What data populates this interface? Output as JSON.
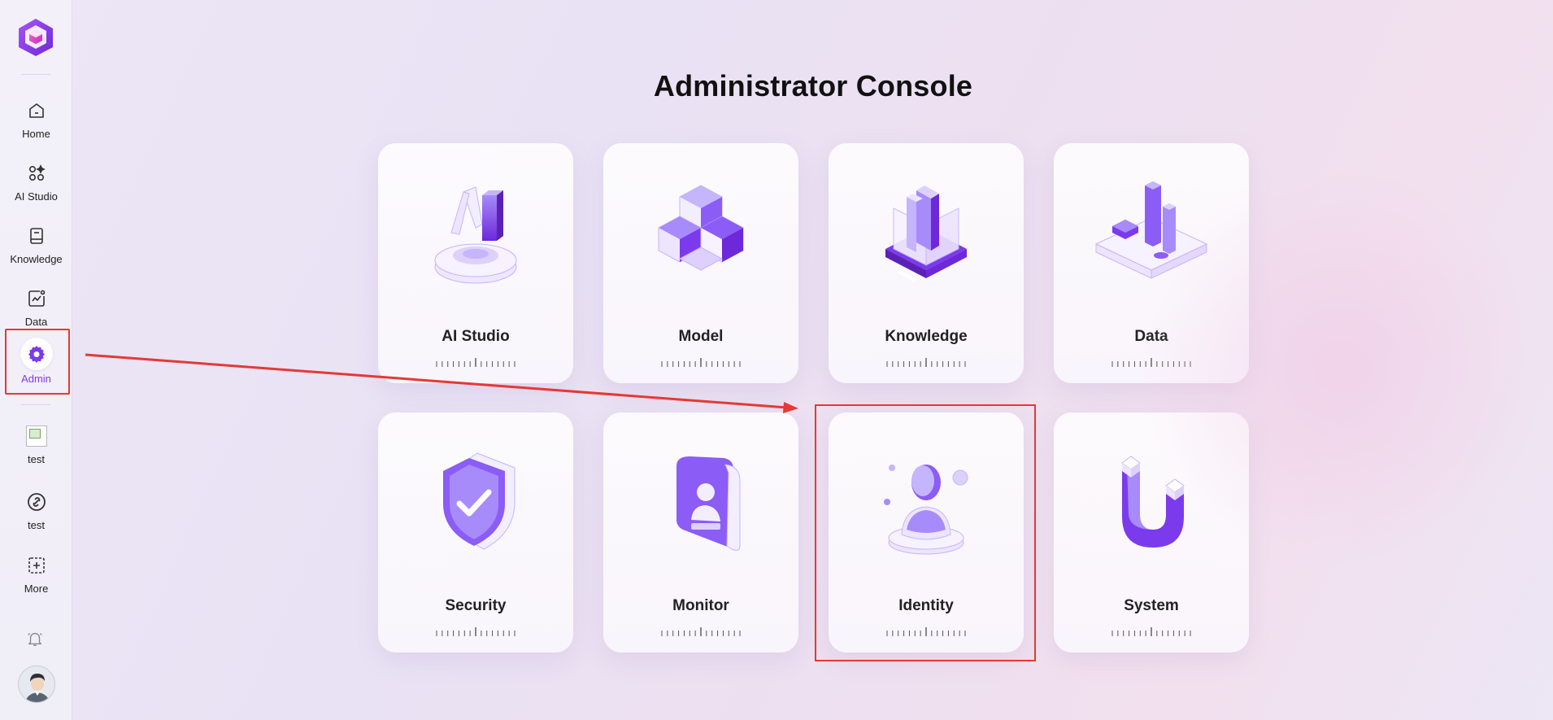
{
  "sidebar": {
    "items": [
      {
        "label": "Home",
        "icon": "home-icon"
      },
      {
        "label": "AI Studio",
        "icon": "apps-sparkle-icon"
      },
      {
        "label": "Knowledge",
        "icon": "book-icon"
      },
      {
        "label": "Data",
        "icon": "chart-icon"
      },
      {
        "label": "Admin",
        "icon": "gear-icon",
        "active": true
      },
      {
        "label": "test",
        "icon": "broken-image-icon"
      },
      {
        "label": "test",
        "icon": "link-circle-icon"
      },
      {
        "label": "More",
        "icon": "add-square-icon"
      }
    ],
    "accent_color": "#7c3aed"
  },
  "main": {
    "title": "Administrator Console",
    "cards": [
      {
        "label": "AI Studio",
        "icon": "ai-studio-3d-icon"
      },
      {
        "label": "Model",
        "icon": "cubes-3d-icon"
      },
      {
        "label": "Knowledge",
        "icon": "books-3d-icon"
      },
      {
        "label": "Data",
        "icon": "data-bars-3d-icon"
      },
      {
        "label": "Security",
        "icon": "shield-3d-icon"
      },
      {
        "label": "Monitor",
        "icon": "monitor-badge-3d-icon"
      },
      {
        "label": "Identity",
        "icon": "person-3d-icon"
      },
      {
        "label": "System",
        "icon": "magnet-3d-icon"
      }
    ]
  },
  "annotation_color": "#e53935"
}
